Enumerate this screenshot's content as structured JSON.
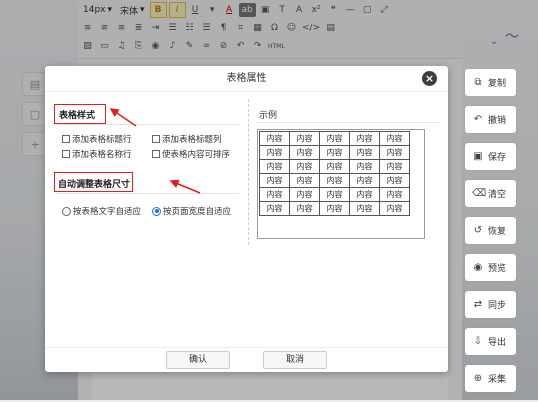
{
  "toolbar": {
    "font_size": "14px",
    "font_family": "宋体",
    "html_label": "HTML"
  },
  "actions": [
    {
      "icon": "copy-icon",
      "label": "复制"
    },
    {
      "icon": "undo-icon",
      "label": "撤销"
    },
    {
      "icon": "save-icon",
      "label": "保存"
    },
    {
      "icon": "trash-icon",
      "label": "清空"
    },
    {
      "icon": "restore-icon",
      "label": "恢复"
    },
    {
      "icon": "eye-icon",
      "label": "预览"
    },
    {
      "icon": "sync-icon",
      "label": "同步"
    },
    {
      "icon": "export-icon",
      "label": "导出"
    },
    {
      "icon": "collect-icon",
      "label": "采集"
    }
  ],
  "dialog": {
    "title": "表格属性",
    "table_style_label": "表格样式",
    "options": {
      "title_row": "添加表格标题行",
      "title_col": "添加表格标题列",
      "caption_row": "添加表格名称行",
      "sortable": "使表格内容可排序"
    },
    "autosize_label": "自动调整表格尺寸",
    "radios": {
      "fit_text": "按表格文字自适应",
      "fit_page": "按页面宽度自适应"
    },
    "preview_label": "示例",
    "preview_cell": "内容",
    "ok": "确认",
    "cancel": "取消"
  },
  "colors": {
    "annotation_red": "#e02020",
    "radio_blue": "#1a73e8"
  }
}
